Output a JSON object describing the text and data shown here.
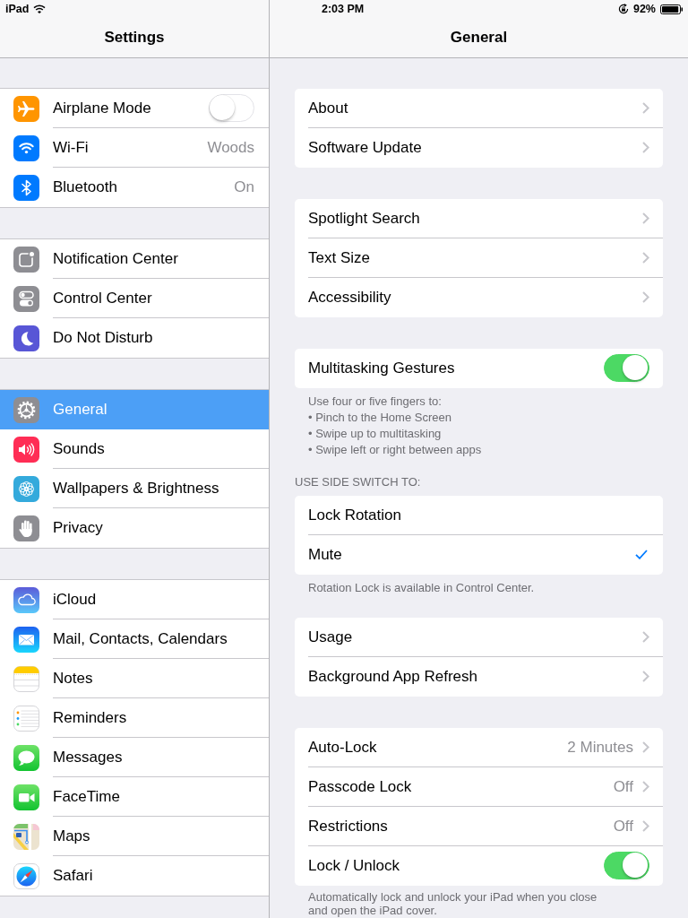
{
  "status_bar": {
    "device": "iPad",
    "time": "2:03 PM",
    "battery": "92%"
  },
  "sidebar": {
    "title": "Settings",
    "groups": [
      {
        "items": [
          {
            "kind": "toggle",
            "label": "Airplane Mode",
            "on": false,
            "selected": false
          },
          {
            "kind": "item",
            "label": "Wi-Fi",
            "value": "Woods",
            "selected": false
          },
          {
            "kind": "item",
            "label": "Bluetooth",
            "value": "On",
            "selected": false
          }
        ]
      },
      {
        "items": [
          {
            "kind": "item",
            "label": "Notification Center",
            "selected": false
          },
          {
            "kind": "item",
            "label": "Control Center",
            "selected": false
          },
          {
            "kind": "item",
            "label": "Do Not Disturb",
            "selected": false
          }
        ]
      },
      {
        "items": [
          {
            "kind": "item",
            "label": "General",
            "selected": true
          },
          {
            "kind": "item",
            "label": "Sounds",
            "selected": false
          },
          {
            "kind": "item",
            "label": "Wallpapers & Brightness",
            "selected": false
          },
          {
            "kind": "item",
            "label": "Privacy",
            "selected": false
          }
        ]
      },
      {
        "items": [
          {
            "kind": "item",
            "label": "iCloud",
            "selected": false
          },
          {
            "kind": "item",
            "label": "Mail, Contacts, Calendars",
            "selected": false
          },
          {
            "kind": "item",
            "label": "Notes",
            "selected": false
          },
          {
            "kind": "item",
            "label": "Reminders",
            "selected": false
          },
          {
            "kind": "item",
            "label": "Messages",
            "selected": false
          },
          {
            "kind": "item",
            "label": "FaceTime",
            "selected": false
          },
          {
            "kind": "item",
            "label": "Maps",
            "selected": false
          },
          {
            "kind": "item",
            "label": "Safari",
            "selected": false
          }
        ]
      }
    ]
  },
  "detail": {
    "title": "General",
    "sections": [
      {
        "items": [
          {
            "kind": "link",
            "label": "About"
          },
          {
            "kind": "link",
            "label": "Software Update"
          }
        ]
      },
      {
        "items": [
          {
            "kind": "link",
            "label": "Spotlight Search"
          },
          {
            "kind": "link",
            "label": "Text Size"
          },
          {
            "kind": "link",
            "label": "Accessibility"
          }
        ]
      },
      {
        "items": [
          {
            "kind": "toggle",
            "label": "Multitasking Gestures",
            "on": true
          }
        ],
        "footer": [
          "Use four or five fingers to:",
          "• Pinch to the Home Screen",
          "• Swipe up to multitasking",
          "• Swipe left or right between apps"
        ]
      },
      {
        "header": "USE SIDE SWITCH TO:",
        "items": [
          {
            "kind": "option",
            "label": "Lock Rotation",
            "selected": false
          },
          {
            "kind": "option",
            "label": "Mute",
            "selected": true
          }
        ],
        "footer": [
          "Rotation Lock is available in Control Center."
        ]
      },
      {
        "items": [
          {
            "kind": "link",
            "label": "Usage"
          },
          {
            "kind": "link",
            "label": "Background App Refresh"
          }
        ]
      },
      {
        "items": [
          {
            "kind": "link",
            "label": "Auto-Lock",
            "value": "2 Minutes"
          },
          {
            "kind": "link",
            "label": "Passcode Lock",
            "value": "Off"
          },
          {
            "kind": "link",
            "label": "Restrictions",
            "value": "Off"
          },
          {
            "kind": "toggle",
            "label": "Lock / Unlock",
            "on": true
          }
        ],
        "footer": [
          "Automatically lock and unlock your iPad when you close",
          "and open the iPad cover."
        ]
      }
    ]
  }
}
